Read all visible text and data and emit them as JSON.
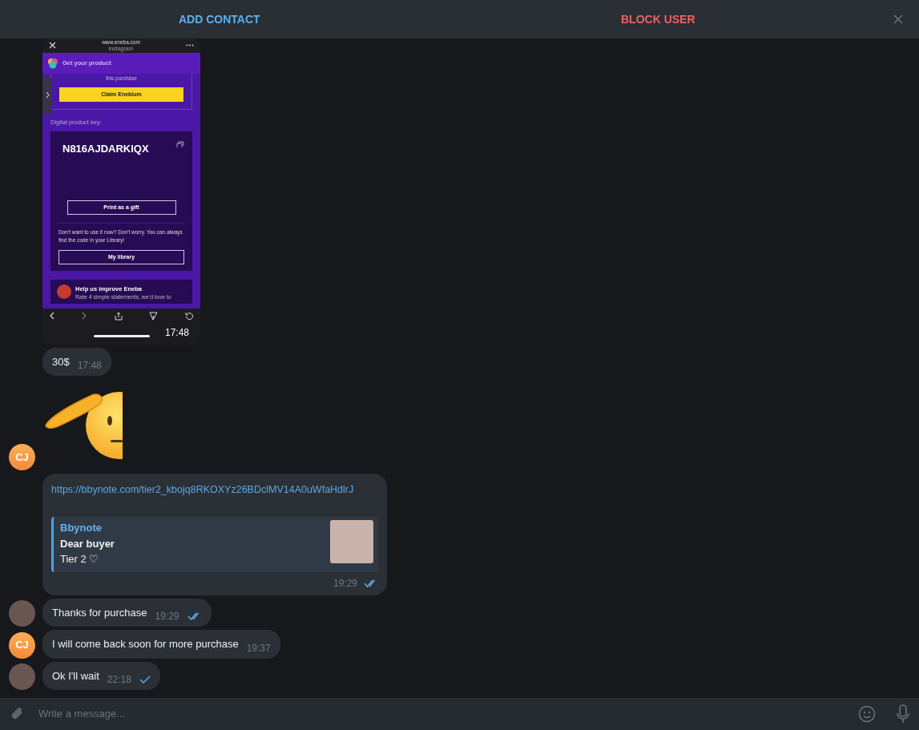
{
  "header": {
    "actions": [
      {
        "label": "ADD CONTACT",
        "kind": "primary"
      },
      {
        "label": "BLOCK USER",
        "kind": "danger"
      }
    ]
  },
  "groups": [
    {
      "avatar": {
        "kind": "initials",
        "text": "CJ"
      },
      "messages": [
        {
          "kind": "screenshot",
          "time": "17:48",
          "screen": {
            "url": "www.eneba.com",
            "source": "Instagram",
            "header_title": "Get your product",
            "partial_text": "this purchase",
            "claim_button": "Claim Enebium",
            "key_label": "Digital product key:",
            "key": "N816AJDARKIQX",
            "gift_button": "Print as a gift",
            "note": "Don't want to use it now? Don't worry. You can always find the code in your Library!",
            "library_button": "My library",
            "survey_title": "Help us improve Eneba",
            "survey_text": "Rate 4 simple statements, we'd love to"
          }
        },
        {
          "kind": "text",
          "text": "30$",
          "time": "17:48"
        },
        {
          "kind": "sticker"
        }
      ]
    },
    {
      "avatar": {
        "kind": "photo"
      },
      "messages": [
        {
          "kind": "link",
          "url": "https://bbynote.com/tier2_kbojq8RKOXYz26BDclMV14A0uWfaHdlrJ",
          "preview": {
            "site": "Bbynote",
            "title": "Dear buyer",
            "description": "Tier 2 ♡"
          },
          "time": "19:29",
          "sent": true,
          "read": true
        },
        {
          "kind": "text",
          "text": "Thanks for purchase",
          "time": "19:29",
          "sent": true,
          "read": true
        }
      ]
    },
    {
      "avatar": {
        "kind": "initials",
        "text": "CJ"
      },
      "messages": [
        {
          "kind": "text",
          "text": "I will come back soon for more purchase",
          "time": "19:37"
        }
      ]
    },
    {
      "avatar": {
        "kind": "photo"
      },
      "messages": [
        {
          "kind": "text",
          "text": "Ok I'll wait",
          "time": "22:18",
          "sent": true,
          "read": false
        }
      ]
    }
  ],
  "composer": {
    "placeholder": "Write a message..."
  }
}
